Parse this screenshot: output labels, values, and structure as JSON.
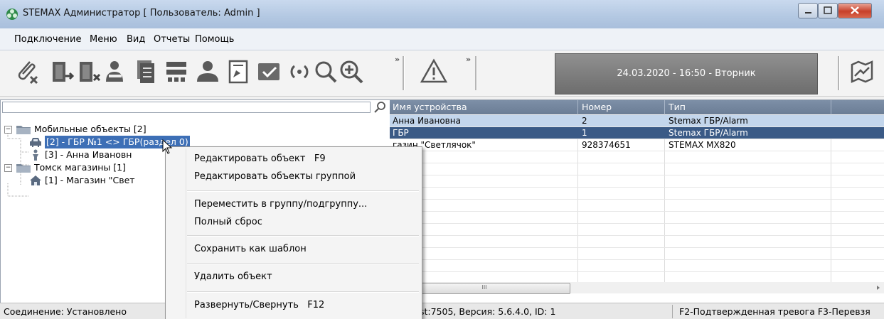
{
  "window": {
    "title": "STEMAX Администратор [ Пользователь: Admin ]",
    "accent_color": "#3d6fb6"
  },
  "menubar": {
    "items": [
      "Подключение",
      "Меню",
      "Вид",
      "Отчеты",
      "Помощь"
    ]
  },
  "toolbar": {
    "icons": [
      "clip-remove-icon",
      "door-exit-icon",
      "door-remove-icon",
      "people-icon",
      "document-stack-icon",
      "network-icon",
      "person-group-icon",
      "document-edit-icon",
      "checkmark-icon",
      "radio-signal-icon",
      "search-icon",
      "zoom-in-icon",
      "warning-icon",
      "map-icon"
    ],
    "datetime": "24.03.2020 - 16:50 - Вторник",
    "chevron": "»"
  },
  "tree": {
    "search_value": "",
    "nodes": [
      {
        "label": "Мобильные объекты [2]",
        "expander": "−",
        "icon": "folder-icon"
      },
      {
        "label": "[2] - ГБР №1 <> ГБР(раздел 0)",
        "icon": "car-icon",
        "selected": true
      },
      {
        "label": "[3] - Анна Ивановн",
        "icon": "person-icon"
      },
      {
        "label": "Томск магазины [1]",
        "expander": "−",
        "icon": "folder-icon"
      },
      {
        "label": "[1] - Магазин \"Свет",
        "icon": "house-icon"
      }
    ]
  },
  "grid": {
    "columns": [
      "Имя устройства",
      "Номер",
      "Тип"
    ],
    "rows": [
      {
        "name": "Анна Ивановна",
        "number": "2",
        "type": "Stemax ГБР/Alarm",
        "state": "highlight"
      },
      {
        "name": "ГБР",
        "number": "1",
        "type": "Stemax ГБР/Alarm",
        "state": "selected"
      },
      {
        "name": "газин \"Светлячок\"",
        "number": "928374651",
        "type": "STEMAX MX820",
        "state": "normal"
      }
    ],
    "scroll_thumb": "III"
  },
  "statusbar": {
    "connection": "Соединение: Установлено",
    "server": "st:7505, Версия: 5.6.4.0, ID: 1",
    "hotkeys": "F2-Подтвержденная тревога  F3-Перевзя"
  },
  "context_menu": {
    "items": [
      {
        "label": "Редактировать объект",
        "shortcut": "F9"
      },
      {
        "label": "Редактировать объекты группой",
        "shortcut": ""
      },
      {
        "label": "Переместить в группу/подгруппу...",
        "shortcut": ""
      },
      {
        "label": "Полный сброс",
        "shortcut": ""
      },
      {
        "label": "Сохранить как шаблон",
        "shortcut": ""
      },
      {
        "label": "Удалить объект",
        "shortcut": ""
      },
      {
        "label": "Развернуть/Свернуть",
        "shortcut": "F12"
      }
    ]
  }
}
